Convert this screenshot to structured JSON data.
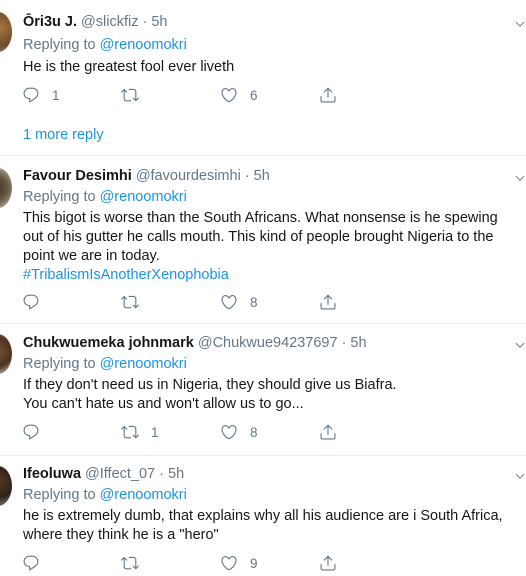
{
  "tweets": [
    {
      "name": "Ōri3u J.",
      "handle": "@slickfiz",
      "time": "· 5h",
      "replying_prefix": "Replying to ",
      "replying_to": "@renoomokri",
      "lines": [
        "He is the greatest fool ever liveth"
      ],
      "reply_count": "1",
      "retweet_count": "",
      "like_count": "6",
      "more_replies": "1 more reply"
    },
    {
      "name": "Favour Desimhi",
      "handle": "@favourdesimhi",
      "time": "· 5h",
      "replying_prefix": "Replying to ",
      "replying_to": "@renoomokri",
      "lines": [
        "This bigot is worse than the South Africans. What nonsense is he spewing",
        "out of his gutter he calls mouth. This kind of people brought Nigeria to the",
        "point we are in today."
      ],
      "hashtag": "#TribalismIsAnotherXenophobia",
      "reply_count": "",
      "retweet_count": "",
      "like_count": "8"
    },
    {
      "name": "Chukwuemeka johnmark",
      "handle": "@Chukwue94237697",
      "time": "· 5h",
      "replying_prefix": "Replying to ",
      "replying_to": "@renoomokri",
      "lines": [
        "If they don't need us in Nigeria,  they should give us Biafra.",
        "You can't hate us and won't allow us to go..."
      ],
      "reply_count": "",
      "retweet_count": "1",
      "like_count": "8"
    },
    {
      "name": "Ifeoluwa",
      "handle": "@Iffect_07",
      "time": "· 5h",
      "replying_prefix": "Replying to ",
      "replying_to": "@renoomokri",
      "lines": [
        "he is extremely dumb, that explains why all his audience are i South Africa,",
        "where they think he is a \"hero\""
      ],
      "reply_count": "",
      "retweet_count": "",
      "like_count": "9"
    }
  ],
  "icons": {
    "reply": "reply-icon",
    "retweet": "retweet-icon",
    "like": "heart-icon",
    "share": "share-icon",
    "caret": "chevron-down-icon"
  },
  "colors": {
    "link": "#1b95e0",
    "muted": "#657786",
    "text": "#14171a",
    "divider": "#e6ecf0"
  }
}
